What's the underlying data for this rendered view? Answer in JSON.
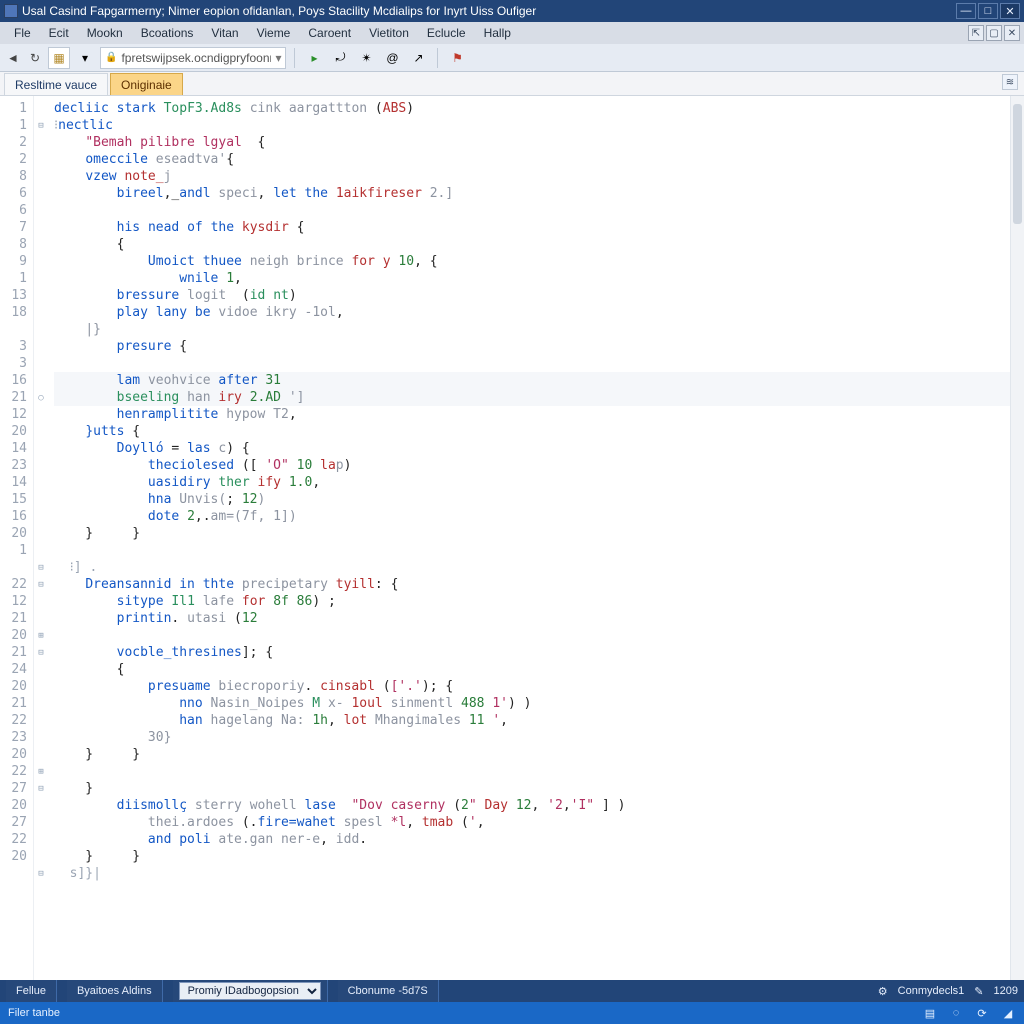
{
  "window": {
    "title": "Usal Casind Fapgarmerny; Nimer eopion ofidanlan, Poys Stacility  Mcdialips for Inyrt Uiss Oufiger"
  },
  "menu": [
    "Fle",
    "Ecit",
    "Mookn",
    "Bcoations",
    "Vitan",
    "Vieme",
    "Caroent",
    "Vietiton",
    "Eclucle",
    "Hallp"
  ],
  "toolbar": {
    "address": "fpretswijpsek.ocndigpryfoonn"
  },
  "tabs": [
    {
      "label": "Resltime vauce",
      "active": false
    },
    {
      "label": "Oniginaie",
      "active": true
    }
  ],
  "code": {
    "lines": [
      {
        "n": "1",
        "indent": 0,
        "html": "<span class='k-blue'>decliic</span> <span class='k-blue'>stark</span> <span class='k-green'>TopF3.Ad8s</span> <span class='k-grey'>cink aargattton</span> (<span class='k-red'>ABS</span>)"
      },
      {
        "n": "1",
        "indent": 0,
        "html": "<span class='k-comm'>⁝</span><span class='k-blue'>nectlic</span>",
        "fold": "-"
      },
      {
        "n": "2",
        "indent": 1,
        "html": "<span class='k-str'>\"Bemah pilibre lgyal</span>  {"
      },
      {
        "n": "2",
        "indent": 1,
        "html": "<span class='k-blue'>omeccile</span> <span class='k-grey'>eseadtva'</span>{"
      },
      {
        "n": "8",
        "indent": 1,
        "html": "<span class='k-blue'>vzew</span> <span class='k-red'>note_</span><span class='k-grey'>j</span>"
      },
      {
        "n": "6",
        "indent": 2,
        "html": "<span class='k-blue'>bireel</span>,_<span class='k-blue'>andl</span> <span class='k-grey'>speci</span>, <span class='k-blue'>let</span> <span class='k-blue'>the</span> <span class='k-red'>1aikfireser</span> <span class='k-grey'>2.]</span>"
      },
      {
        "n": "6",
        "indent": 2,
        "html": ""
      },
      {
        "n": "7",
        "indent": 2,
        "html": "<span class='k-blue'>his</span> <span class='k-blue'>nead</span> <span class='k-blue'>of</span> <span class='k-blue'>the</span> <span class='k-red'>kysdir</span> {"
      },
      {
        "n": "8",
        "indent": 2,
        "html": "{"
      },
      {
        "n": "9",
        "indent": 3,
        "html": "<span class='k-blue'>Umoict</span> <span class='k-blue'>thuee</span> <span class='k-grey'>neigh</span> <span class='k-grey'>brince</span> <span class='k-red'>for</span> <span class='k-red'>y</span> <span class='k-num'>10</span>, {"
      },
      {
        "n": "1",
        "indent": 4,
        "html": "<span class='k-blue'>wnile</span> <span class='k-num'>1</span>,"
      },
      {
        "n": "13",
        "indent": 2,
        "html": "<span class='k-blue'>bressure</span> <span class='k-grey'>logit</span>  (<span class='k-green'>id</span> <span class='k-green'>nt</span>)"
      },
      {
        "n": "18",
        "indent": 2,
        "html": "<span class='k-blue'>play</span> <span class='k-blue'>lany</span> <span class='k-blue'>be</span> <span class='k-grey'>vidoe</span> <span class='k-grey'>ikry -1ol</span>,"
      },
      {
        "n": "",
        "indent": 1,
        "html": "<span class='k-grey'>|}</span>"
      },
      {
        "n": "3",
        "indent": 2,
        "html": "<span class='k-blue'>presure</span> {"
      },
      {
        "n": "3",
        "indent": 2,
        "html": ""
      },
      {
        "n": "16",
        "indent": 2,
        "html": "<span class='k-blue'>lam</span> <span class='k-grey'>veohvice</span> <span class='k-blue'>after</span> <span class='k-num'>31</span>",
        "hl": true
      },
      {
        "n": "21",
        "indent": 2,
        "html": "<span class='k-green'>bseeling</span> <span class='k-grey'>han</span> <span class='k-red'>iry</span> <span class='k-num'>2.AD</span> <span class='k-grey'>']</span>",
        "fold": "o",
        "hl": true
      },
      {
        "n": "12",
        "indent": 2,
        "html": "<span class='k-blue'>henramplitite</span> <span class='k-grey'>hypow</span> <span class='k-grey'>T2</span>,"
      },
      {
        "n": "20",
        "indent": 1,
        "html": "<span class='k-blue'>}utts</span> {"
      },
      {
        "n": "14",
        "indent": 2,
        "html": "<span class='k-blue'>Doylló</span> = <span class='k-blue'>las</span> <span class='k-grey'>c</span>) {"
      },
      {
        "n": "23",
        "indent": 3,
        "html": "<span class='k-blue'>theciolesed</span> ([ <span class='k-str'>'O\"</span> <span class='k-num'>10</span> <span class='k-red'>la</span><span class='k-grey'>p</span>)"
      },
      {
        "n": "14",
        "indent": 3,
        "html": "<span class='k-blue'>uasidiry</span> <span class='k-green'>ther</span> <span class='k-red'>ify</span> <span class='k-num'>1.0</span>,"
      },
      {
        "n": "15",
        "indent": 3,
        "html": "<span class='k-blue'>hna</span> <span class='k-grey'>Unvis(</span>; <span class='k-num'>12</span><span class='k-grey'>)</span>"
      },
      {
        "n": "16",
        "indent": 3,
        "html": "<span class='k-blue'>dote</span> <span class='k-num'>2</span>,.<span class='k-grey'>am=(7f,</span> <span class='k-grey'>1])</span>"
      },
      {
        "n": "20",
        "indent": 1,
        "html": "}     }"
      },
      {
        "n": "1",
        "indent": 0,
        "html": ""
      },
      {
        "n": "",
        "indent": 0,
        "html": "<span class='k-comm'>  ⁝] .</span>",
        "fold": "-"
      },
      {
        "n": "22",
        "indent": 1,
        "html": "<span class='k-blue'>Dreansannid</span> <span class='k-blue'>in</span> <span class='k-blue'>thte</span> <span class='k-grey'>precipetary</span> <span class='k-red'>tyill</span>: {",
        "fold": "-"
      },
      {
        "n": "12",
        "indent": 2,
        "html": "<span class='k-blue'>sitype</span> <span class='k-green'>Il1</span> <span class='k-grey'>lafe</span> <span class='k-red'>for</span> <span class='k-num'>8f 86</span>) ;"
      },
      {
        "n": "21",
        "indent": 2,
        "html": "<span class='k-blue'>printin</span>. <span class='k-grey'>utasi</span> (<span class='k-num'>12</span>"
      },
      {
        "n": "20",
        "indent": 2,
        "html": "",
        "fold": "+"
      },
      {
        "n": "21",
        "indent": 2,
        "html": "<span class='k-blue'>vocble_thresines</span>]; {",
        "fold": "-"
      },
      {
        "n": "24",
        "indent": 2,
        "html": "{"
      },
      {
        "n": "20",
        "indent": 3,
        "html": "<span class='k-blue'>presuame</span> <span class='k-grey'>biecroporiy</span>. <span class='k-red'>cinsabl</span> (<span class='k-str'>['.'</span>); {"
      },
      {
        "n": "21",
        "indent": 4,
        "html": "<span class='k-blue'>nno</span> <span class='k-grey'>Nasin_Noipes</span> <span class='k-green'>M</span> <span class='k-grey'>x-</span> <span class='k-red'>1oul</span> <span class='k-grey'>sinmentl</span> <span class='k-num'>488</span> <span class='k-str'>1'</span>) )"
      },
      {
        "n": "22",
        "indent": 4,
        "html": "<span class='k-blue'>han</span> <span class='k-grey'>hagelang</span> <span class='k-grey'>Na:</span> <span class='k-num'>1h</span>, <span class='k-red'>lot</span> <span class='k-grey'>Mhangimales</span> <span class='k-num'>11</span> <span class='k-str'>'</span>,"
      },
      {
        "n": "23",
        "indent": 3,
        "html": "<span class='k-grey'>30}</span>"
      },
      {
        "n": "20",
        "indent": 1,
        "html": "}     }"
      },
      {
        "n": "22",
        "indent": 0,
        "html": "",
        "fold": "+"
      },
      {
        "n": "27",
        "indent": 1,
        "html": "}",
        "fold": "-"
      },
      {
        "n": "20",
        "indent": 2,
        "html": "<span class='k-blue'>diismollç</span> <span class='k-grey'>sterry</span> <span class='k-grey'>wohell</span> <span class='k-blue'>lase</span>  <span class='k-str'>\"Dov caserny</span> (<span class='k-num'>2</span><span class='k-str'>\"</span> <span class='k-red'>Day</span> <span class='k-num'>12</span>, <span class='k-str'>'2</span>,<span class='k-str'>'I\"</span> ] )"
      },
      {
        "n": "27",
        "indent": 3,
        "html": "<span class='k-grey'>thei.ardoes</span> (.<span class='k-blue'>fire=wahet</span> <span class='k-grey'>spesl</span> <span class='k-str'>*l</span>, <span class='k-red'>tmab</span> (<span class='k-str'>'</span>,"
      },
      {
        "n": "22",
        "indent": 3,
        "html": "<span class='k-blue'>and</span> <span class='k-blue'>poli</span> <span class='k-grey'>ate.gan</span> <span class='k-grey'>ner-e</span>, <span class='k-grey'>idd</span>."
      },
      {
        "n": "20",
        "indent": 1,
        "html": "}     }"
      },
      {
        "n": "",
        "indent": 0,
        "html": "<span class='k-comm'>  s]}|</span>",
        "fold": "-"
      }
    ]
  },
  "status1": {
    "left1": "Fellue",
    "left2": "Byaitoes Aldins",
    "select": "Promiy IDadbogopsion",
    "left3": "Cbonume -5d7S",
    "right1": "Conmydecls1",
    "right2": "1209"
  },
  "status2": {
    "left": "Filer tanbe"
  }
}
